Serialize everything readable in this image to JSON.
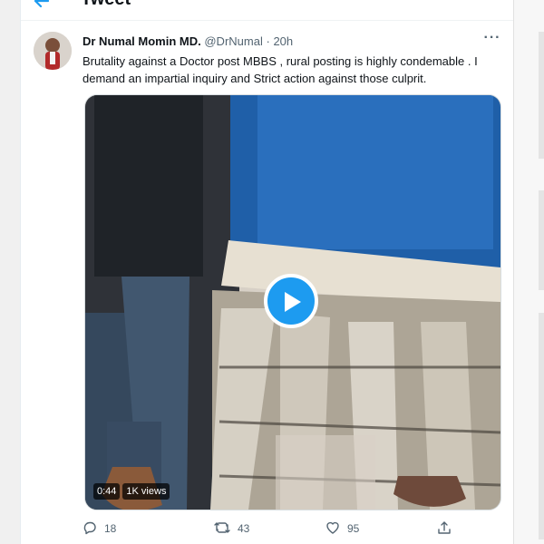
{
  "header": {
    "title": "Tweet"
  },
  "tweet": {
    "author_name": "Dr Numal Momin MD.",
    "handle": "@DrNumal",
    "separator": "·",
    "time": "20h",
    "text_line1": "Brutality against a Doctor post MBBS , rural posting is highly condemable . I",
    "text_line2": "demand an impartial inquiry and  Strict action against those culprit.",
    "video": {
      "duration": "0:44",
      "views": "1K views"
    },
    "actions": {
      "replies": "18",
      "retweets": "43",
      "likes": "95"
    }
  },
  "colors": {
    "accent": "#1d9bf0",
    "text": "#0f1419",
    "muted": "#536471"
  },
  "icons": [
    "back-arrow-icon",
    "more-icon",
    "play-icon",
    "reply-icon",
    "retweet-icon",
    "like-icon",
    "share-icon"
  ]
}
